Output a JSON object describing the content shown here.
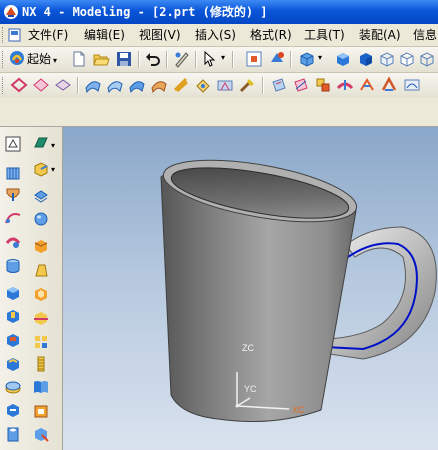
{
  "window": {
    "title": "NX 4 - Modeling - [2.prt (修改的) ]",
    "app_icon": "nx-app-icon"
  },
  "menu": {
    "items": [
      {
        "label": "文件(F)"
      },
      {
        "label": "编辑(E)"
      },
      {
        "label": "视图(V)"
      },
      {
        "label": "插入(S)"
      },
      {
        "label": "格式(R)"
      },
      {
        "label": "工具(T)"
      },
      {
        "label": "装配(A)"
      },
      {
        "label": "信息"
      }
    ]
  },
  "standard_toolbar": {
    "start_label": "起始"
  },
  "viewport": {
    "axis_labels": {
      "z": "ZC",
      "y": "YC",
      "x": "XC"
    },
    "colors": {
      "background_top": "#89a7c9",
      "background_bottom": "#d9e2ee",
      "model": "#8a8a8a",
      "edge_highlight": "#0010c8"
    }
  }
}
